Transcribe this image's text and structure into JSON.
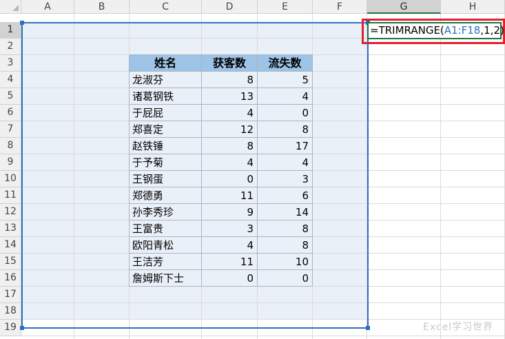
{
  "columns": [
    "A",
    "B",
    "C",
    "D",
    "E",
    "F",
    "G",
    "H"
  ],
  "rows": [
    "1",
    "2",
    "3",
    "4",
    "5",
    "6",
    "7",
    "8",
    "9",
    "10",
    "11",
    "12",
    "13",
    "14",
    "15",
    "16",
    "17",
    "18",
    "19"
  ],
  "formula": {
    "prefix": "=TRIMRANGE(",
    "ref": "A1:F18",
    "suffix": ",1,2)"
  },
  "table": {
    "headers": [
      "姓名",
      "获客数",
      "流失数"
    ],
    "rows": [
      [
        "龙淑芬",
        "8",
        "5"
      ],
      [
        "诸葛钢铁",
        "13",
        "4"
      ],
      [
        "于屁屁",
        "4",
        "0"
      ],
      [
        "郑喜定",
        "12",
        "8"
      ],
      [
        "赵铁锤",
        "8",
        "17"
      ],
      [
        "于予菊",
        "4",
        "4"
      ],
      [
        "王钢蛋",
        "0",
        "3"
      ],
      [
        "郑德勇",
        "11",
        "6"
      ],
      [
        "孙李秀珍",
        "9",
        "14"
      ],
      [
        "王富贵",
        "3",
        "8"
      ],
      [
        "欧阳青松",
        "4",
        "8"
      ],
      [
        "王洁芳",
        "11",
        "10"
      ],
      [
        "詹姆斯下士",
        "0",
        "0"
      ]
    ]
  },
  "watermark": "Excel学习世界",
  "colors": {
    "accent": "#1a7343",
    "highlight_box": "#e0202a",
    "range_ref": "#2f6fbf",
    "table_header": "#9dc3e6",
    "range_fill": "#eaf0f8"
  }
}
